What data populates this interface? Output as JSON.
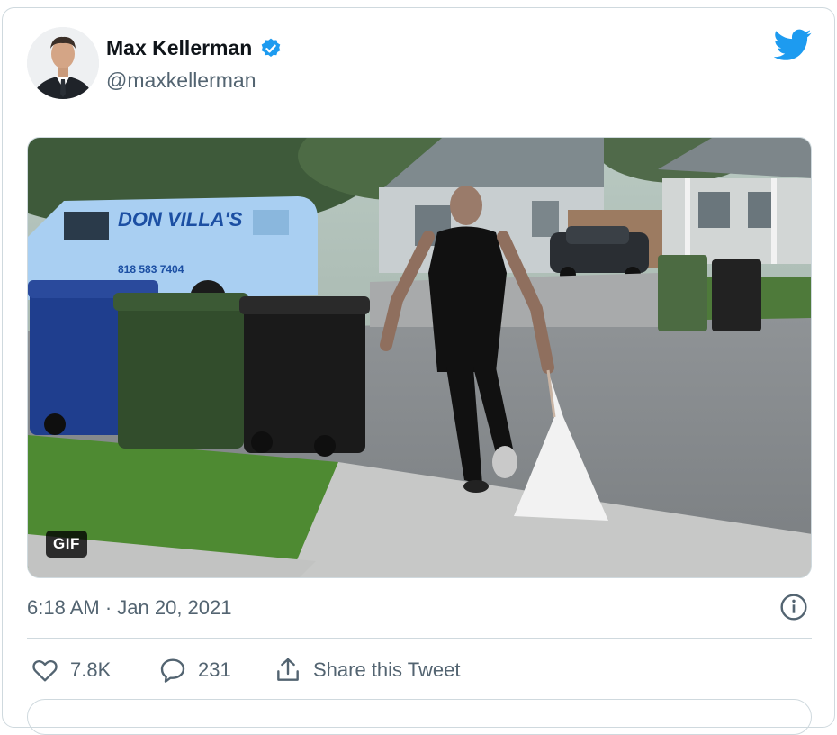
{
  "tweet": {
    "author_name": "Max Kellerman",
    "author_handle": "@maxkellerman",
    "verified": true,
    "media": {
      "badge": "GIF",
      "van_text": "DON VILLA'S",
      "van_phone": "818 583 7404"
    },
    "timestamp": "6:18 AM · Jan 20, 2021",
    "likes": "7.8K",
    "replies": "231",
    "share_label": "Share this Tweet"
  },
  "icons": {
    "logo": "twitter-bird-icon",
    "verified": "verified-badge-icon",
    "info": "info-icon",
    "like": "heart-icon",
    "reply": "reply-bubble-icon",
    "share": "share-icon"
  },
  "colors": {
    "brand": "#1d9bf0",
    "text_primary": "#0f1419",
    "text_secondary": "#536471",
    "border": "#cfd9de"
  }
}
